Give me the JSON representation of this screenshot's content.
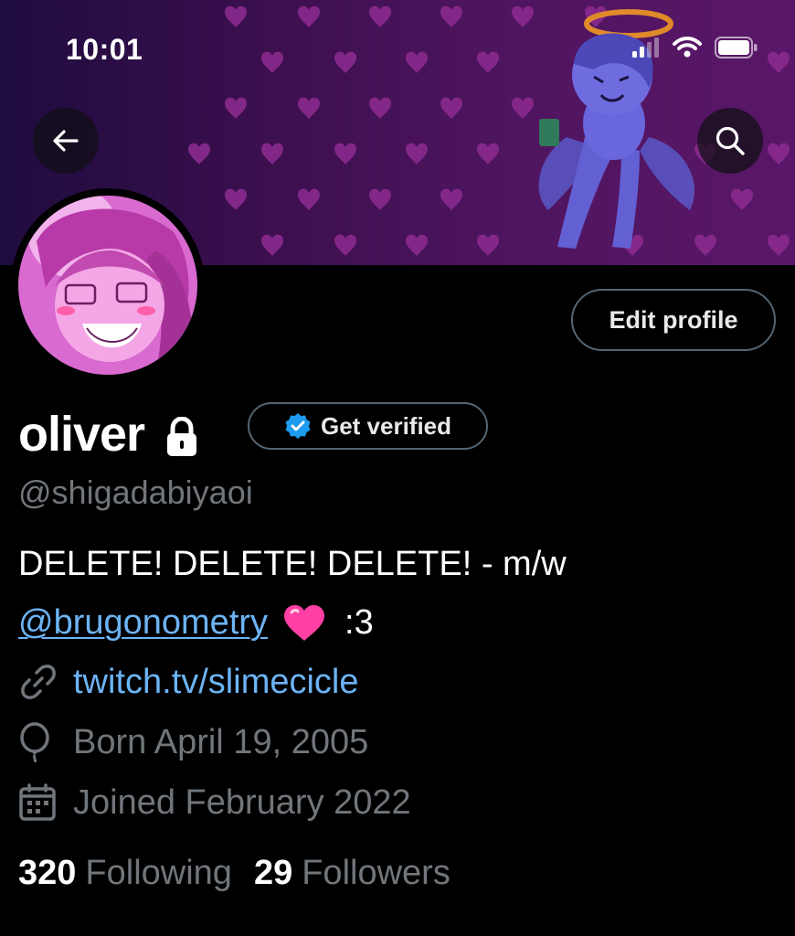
{
  "status_bar": {
    "time": "10:01"
  },
  "nav": {
    "back_icon": "arrow-left-icon",
    "search_icon": "search-icon"
  },
  "profile": {
    "display_name": "oliver",
    "handle": "@shigadabiyaoi",
    "verify_label": "Get verified",
    "edit_label": "Edit profile",
    "bio_line1": "DELETE! DELETE! DELETE! - m/w",
    "bio_mention": "@brugonometry",
    "bio_suffix": ":3",
    "website": "twitch.tv/slimecicle",
    "birth": "Born April 19, 2005",
    "joined": "Joined February 2022"
  },
  "stats": {
    "following_count": "320",
    "following_label": "Following",
    "followers_count": "29",
    "followers_label": "Followers"
  },
  "colors": {
    "accent_link": "#6cb4f5",
    "verified_blue": "#1d9bf0",
    "muted": "#71767b",
    "banner_purple": "#4f1560"
  }
}
